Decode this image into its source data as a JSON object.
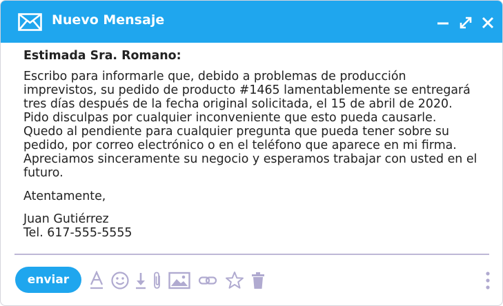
{
  "window": {
    "title": "Nuevo Mensaje",
    "icons": {
      "mail": "envelope-icon",
      "minimize": "minimize-icon",
      "maximize": "expand-icon",
      "close": "close-icon"
    }
  },
  "message": {
    "greeting": "Estimada Sra. Romano:",
    "paragraph": "Escribo para informarle que, debido a problemas de producción imprevistos, su pedido de producto #1465 lamentablemente se entregará tres días después de la fecha original solicitada, el 15 de abril de 2020. Pido disculpas por cualquier inconveniente que esto pueda causarle. Quedo al pendiente para cualquier pregunta que pueda tener sobre su pedido, por correo electrónico o en el teléfono que aparece en mi firma. Apreciamos sinceramente su negocio y esperamos trabajar con usted en el futuro.",
    "closing": "Atentamente,",
    "signature_name": "Juan Gutiérrez",
    "signature_phone": "Tel. 617-555-5555"
  },
  "toolbar": {
    "send_label": "enviar",
    "tools": [
      "text-format-icon",
      "emoji-icon",
      "download-icon",
      "attachment-icon",
      "image-icon",
      "link-icon",
      "star-icon",
      "trash-icon",
      "more-options-icon"
    ]
  },
  "colors": {
    "accent": "#1fa6ee",
    "toolbar_icon": "#b0aad0",
    "divider": "#bdb7d6",
    "text": "#222222"
  }
}
